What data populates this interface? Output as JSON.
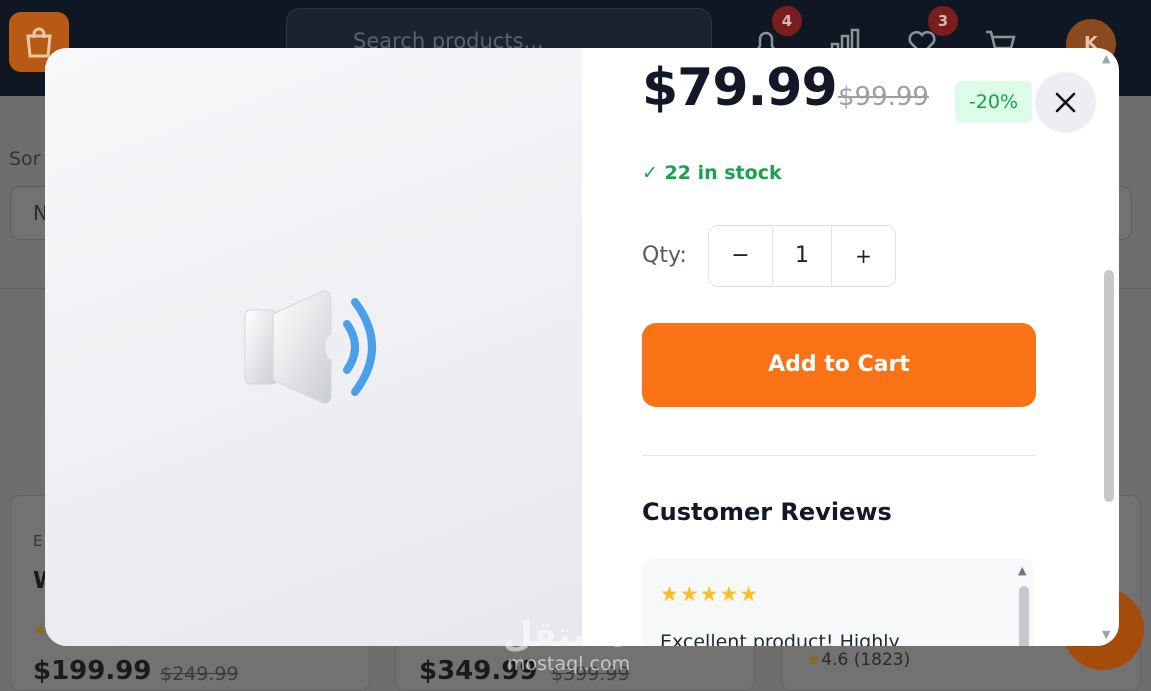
{
  "header": {
    "search_placeholder": "Search products...",
    "notifications_count": "4",
    "wishlist_count": "3",
    "avatar_initial": "K"
  },
  "background": {
    "sort_label": "Sor",
    "select_fragment": "N",
    "cards": [
      {
        "category_fragment": "E",
        "title_fragment": "W",
        "price": "$199.99",
        "old_price": "$249.99"
      },
      {
        "price": "$349.99",
        "old_price": "$399.99"
      },
      {
        "rating": "4.6",
        "reviews_count": "(1823)"
      }
    ],
    "watermark": "مستقل",
    "watermark_url": "mostaql.com"
  },
  "product": {
    "price": "$79.99",
    "old_price": "$99.99",
    "discount": "-20%",
    "stock": "✓ 22 in stock",
    "qty_label": "Qty:",
    "qty_minus": "−",
    "qty_value": "1",
    "qty_plus": "+",
    "add_to_cart": "Add to Cart"
  },
  "reviews": {
    "title": "Customer Reviews",
    "items": [
      {
        "stars": "★★★★★",
        "text": "Excellent product! Highly"
      }
    ]
  },
  "colors": {
    "accent": "#f97316",
    "success": "#16a34a",
    "success_bg": "#dcfce7",
    "star": "#fbbf24"
  }
}
